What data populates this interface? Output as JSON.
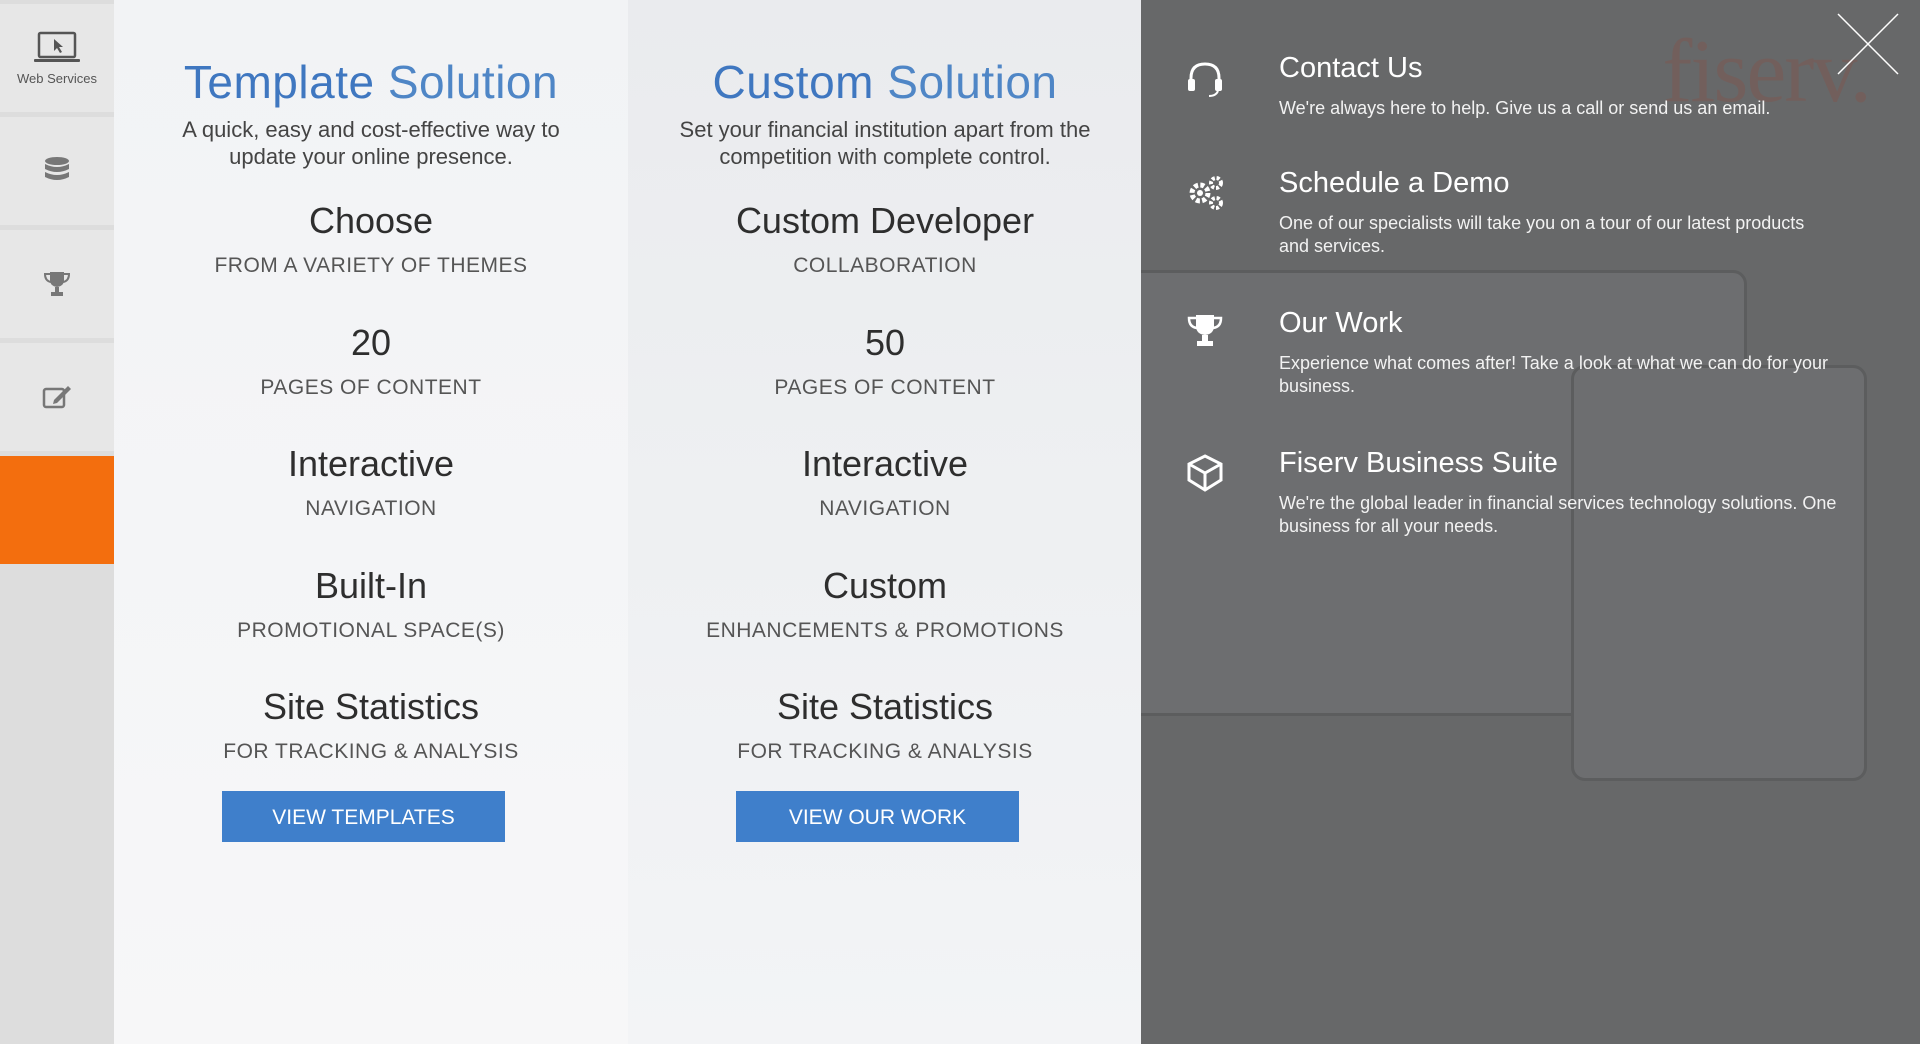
{
  "sidebar": {
    "items": [
      {
        "label": "Web Services",
        "icon": "laptop-cursor-icon"
      },
      {
        "label": "",
        "icon": "database-icon"
      },
      {
        "label": "",
        "icon": "trophy-icon"
      },
      {
        "label": "",
        "icon": "edit-icon"
      },
      {
        "label": "",
        "icon": ""
      }
    ],
    "active_color": "#f36e0e"
  },
  "template": {
    "title_bold": "Template",
    "title_rest": " Solution",
    "description": "A quick, easy and cost-effective way to update your online presence.",
    "features": [
      {
        "title": "Choose",
        "subtitle": "FROM A VARIETY OF THEMES"
      },
      {
        "title": "20",
        "subtitle": "PAGES OF CONTENT"
      },
      {
        "title": "Interactive",
        "subtitle": "NAVIGATION"
      },
      {
        "title": "Built-In",
        "subtitle": "PROMOTIONAL SPACE(S)"
      },
      {
        "title": "Site Statistics",
        "subtitle": "FOR TRACKING & ANALYSIS"
      }
    ],
    "button": "VIEW TEMPLATES"
  },
  "custom": {
    "title_bold": "Custom",
    "title_rest": " Solution",
    "description": "Set your financial institution apart from the competition with complete control.",
    "features": [
      {
        "title": "Custom Developer",
        "subtitle": "COLLABORATION"
      },
      {
        "title": "50",
        "subtitle": "PAGES OF CONTENT"
      },
      {
        "title": "Interactive",
        "subtitle": "NAVIGATION"
      },
      {
        "title": "Custom",
        "subtitle": "ENHANCEMENTS & PROMOTIONS"
      },
      {
        "title": "Site Statistics",
        "subtitle": "FOR TRACKING & ANALYSIS"
      }
    ],
    "button": "VIEW OUR WORK"
  },
  "right_panel": {
    "logo": "fiserv.",
    "items": [
      {
        "icon": "headset-icon",
        "title": "Contact Us",
        "text": "We're always here to help. Give us a call or send us an email."
      },
      {
        "icon": "gears-icon",
        "title": "Schedule a Demo",
        "text": "One of our specialists will take you on a tour of our latest products and services."
      },
      {
        "icon": "trophy-icon",
        "title": "Our Work",
        "text": "Experience what comes after! Take a look at what we can do for your business."
      },
      {
        "icon": "cube-icon",
        "title": "Fiserv Business Suite",
        "text": "We're the global leader in financial services technology solutions. One business for all your needs."
      }
    ]
  }
}
